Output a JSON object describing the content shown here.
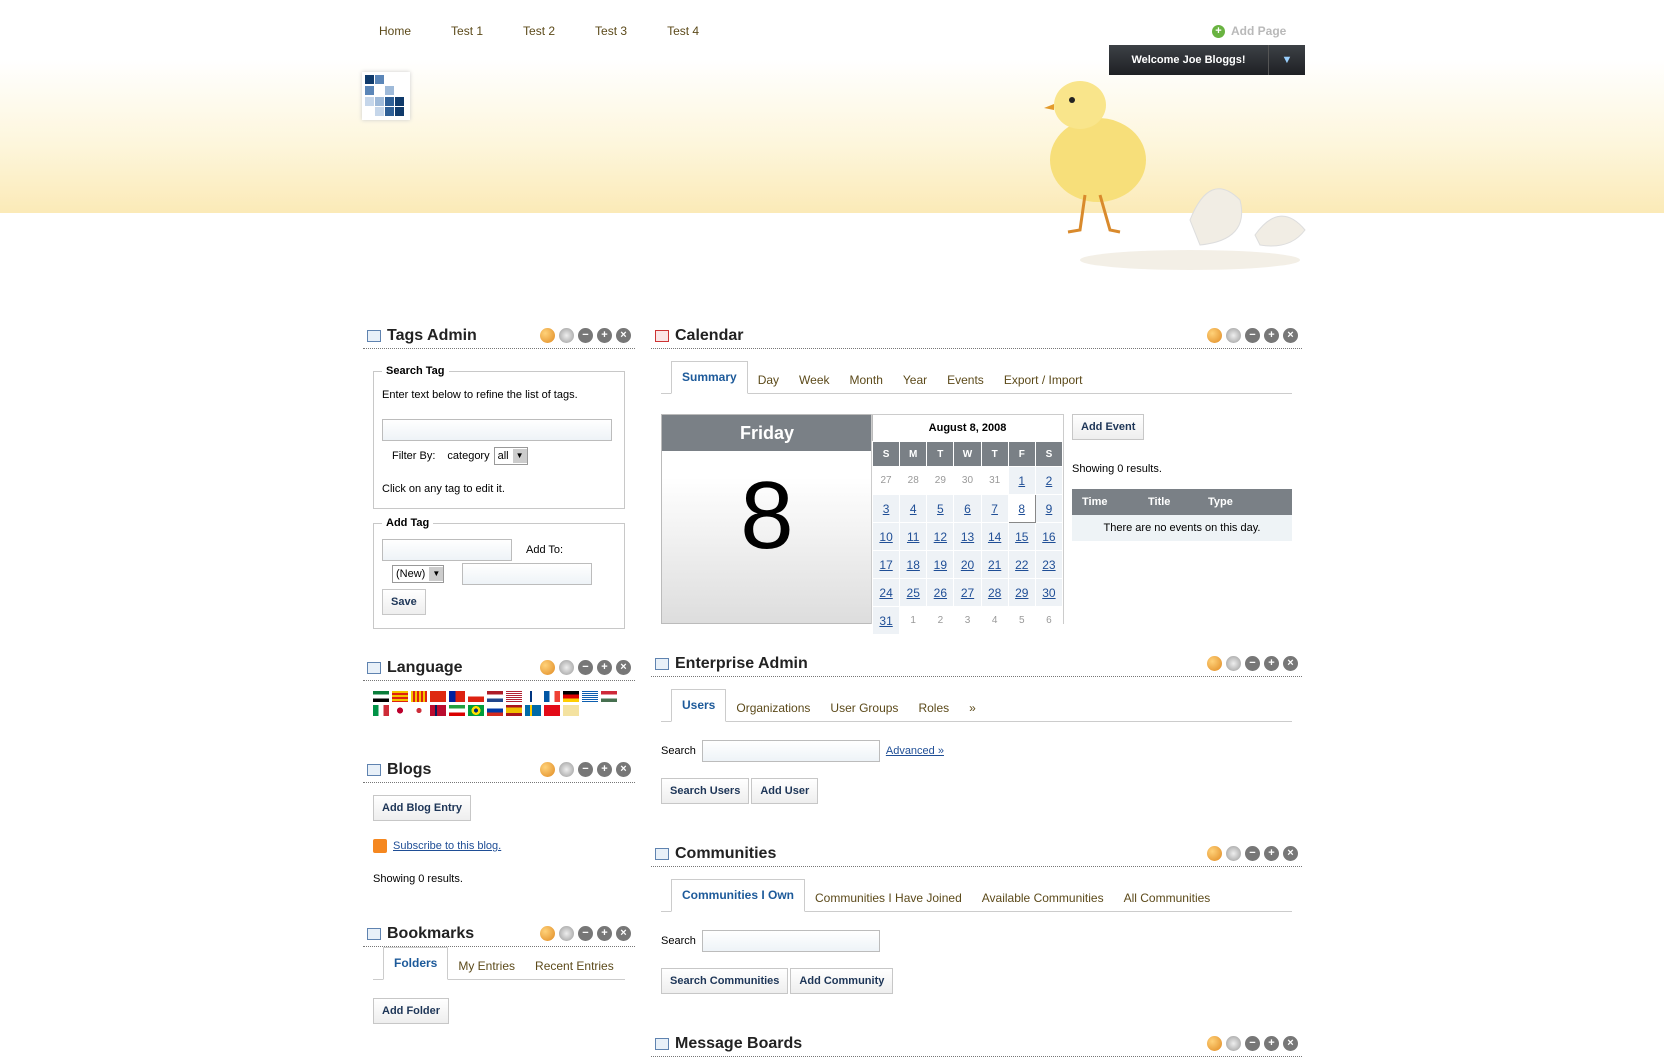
{
  "nav": {
    "items": [
      "Home",
      "Test 1",
      "Test 2",
      "Test 3",
      "Test 4"
    ]
  },
  "header": {
    "add_page": "Add Page",
    "welcome": "Welcome Joe Bloggs!",
    "toggle": "▼"
  },
  "controls": {
    "plus": "+",
    "minus": "−",
    "close": "×"
  },
  "tags_admin": {
    "title": "Tags Admin",
    "search_legend": "Search Tag",
    "search_help": "Enter text below to refine the list of tags.",
    "filter_by": "Filter By:",
    "filter_field": "category",
    "filter_value": "all",
    "click_help": "Click on any tag to edit it.",
    "add_legend": "Add Tag",
    "add_to": "Add To:",
    "add_to_value": "(New)",
    "save": "Save"
  },
  "language": {
    "title": "Language"
  },
  "blogs": {
    "title": "Blogs",
    "add_entry": "Add Blog Entry",
    "subscribe": "Subscribe to this blog.",
    "showing": "Showing 0 results."
  },
  "bookmarks": {
    "title": "Bookmarks",
    "tabs": [
      "Folders",
      "My Entries",
      "Recent Entries"
    ],
    "add_folder": "Add Folder"
  },
  "calendar": {
    "title": "Calendar",
    "tabs": [
      "Summary",
      "Day",
      "Week",
      "Month",
      "Year",
      "Events",
      "Export / Import"
    ],
    "day_name": "Friday",
    "day_number": "8",
    "month_title": "August 8, 2008",
    "weekdays": [
      "S",
      "M",
      "T",
      "W",
      "T",
      "F",
      "S"
    ],
    "weeks": [
      [
        "27",
        "28",
        "29",
        "30",
        "31",
        "1",
        "2"
      ],
      [
        "3",
        "4",
        "5",
        "6",
        "7",
        "8",
        "9"
      ],
      [
        "10",
        "11",
        "12",
        "13",
        "14",
        "15",
        "16"
      ],
      [
        "17",
        "18",
        "19",
        "20",
        "21",
        "22",
        "23"
      ],
      [
        "24",
        "25",
        "26",
        "27",
        "28",
        "29",
        "30"
      ],
      [
        "31",
        "1",
        "2",
        "3",
        "4",
        "5",
        "6"
      ]
    ],
    "add_event": "Add Event",
    "showing": "Showing 0 results.",
    "cols": [
      "Time",
      "Title",
      "Type"
    ],
    "empty": "There are no events on this day."
  },
  "enterprise": {
    "title": "Enterprise Admin",
    "tabs": [
      "Users",
      "Organizations",
      "User Groups",
      "Roles",
      "»"
    ],
    "search_label": "Search",
    "advanced": "Advanced »",
    "search_btn": "Search Users",
    "add_btn": "Add User"
  },
  "communities": {
    "title": "Communities",
    "tabs": [
      "Communities I Own",
      "Communities I Have Joined",
      "Available Communities",
      "All Communities"
    ],
    "search_label": "Search",
    "search_btn": "Search Communities",
    "add_btn": "Add Community"
  },
  "message_boards": {
    "title": "Message Boards"
  }
}
